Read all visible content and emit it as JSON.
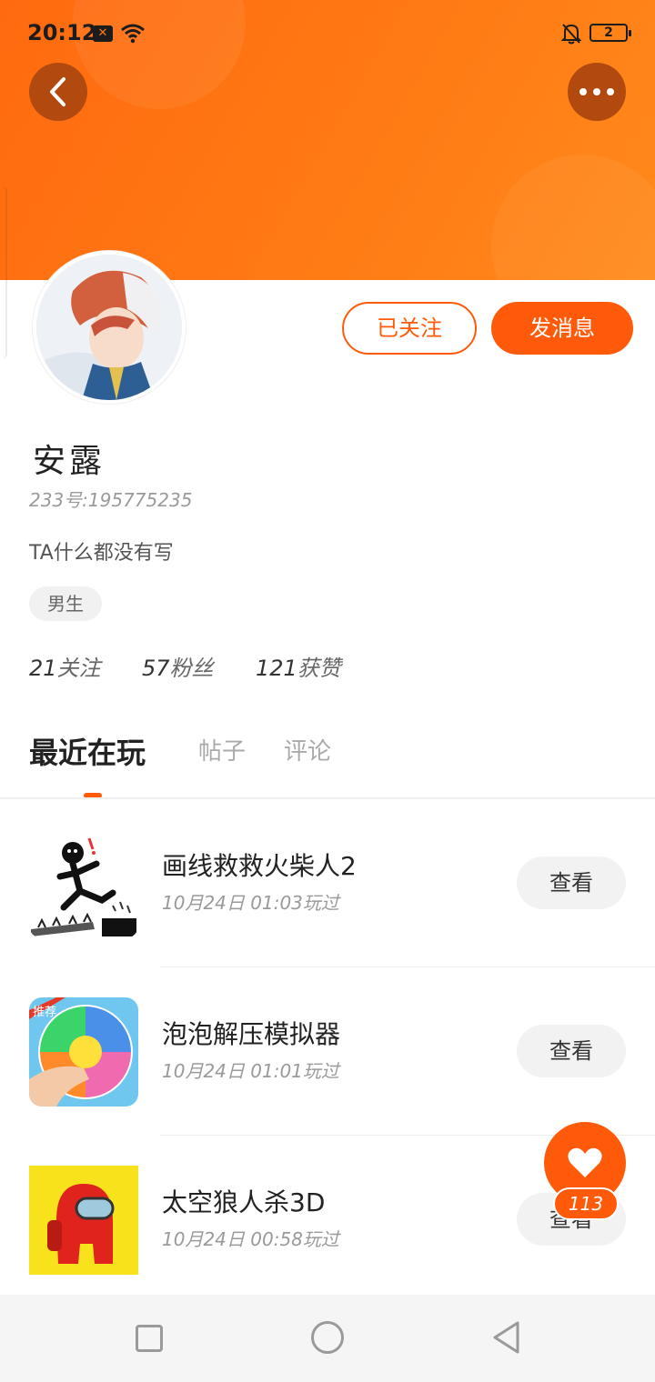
{
  "status_bar": {
    "time": "20:12",
    "battery": "2",
    "icons": [
      "sim-icon",
      "wifi-icon",
      "bell-muted-icon",
      "battery-icon"
    ]
  },
  "header": {
    "back_icon": "chevron-left-icon",
    "more_icon": "more-dots-icon",
    "accent_color": "#ff6a10"
  },
  "profile": {
    "follow_label": "已关注",
    "message_label": "发消息",
    "name": "安露",
    "id_text": "233号:195775235",
    "bio": "TA什么都没有写",
    "gender": "男生",
    "stats": [
      {
        "num": "21",
        "label": "关注"
      },
      {
        "num": "57",
        "label": "粉丝"
      },
      {
        "num": "121",
        "label": "获赞"
      }
    ]
  },
  "tabs": [
    {
      "label": "最近在玩",
      "active": true
    },
    {
      "label": "帖子",
      "active": false
    },
    {
      "label": "评论",
      "active": false
    }
  ],
  "games": [
    {
      "title": "画线救救火柴人2",
      "time": "10月24日 01:03玩过",
      "button": "查看"
    },
    {
      "title": "泡泡解压模拟器",
      "time": "10月24日 01:01玩过",
      "button": "查看",
      "badge": "推荐"
    },
    {
      "title": "太空狼人杀3D",
      "time": "10月24日 00:58玩过",
      "button": "查看"
    }
  ],
  "like": {
    "count": "113",
    "icon": "heart-icon"
  },
  "nav_bar": {
    "icons": [
      "recent-apps-icon",
      "home-icon",
      "back-triangle-icon"
    ]
  }
}
